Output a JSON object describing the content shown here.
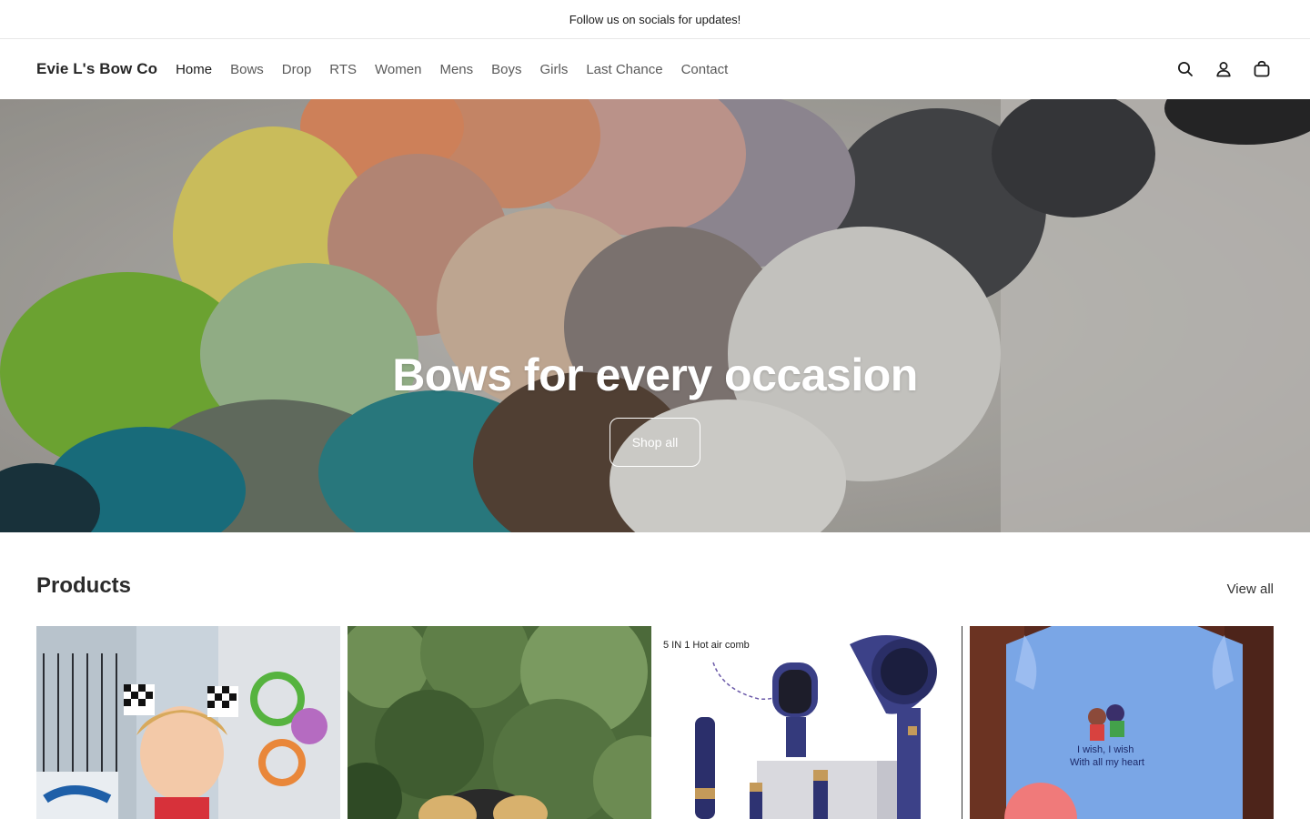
{
  "announcement": {
    "text": "Follow us on socials for updates!"
  },
  "header": {
    "logo": "Evie L's Bow Co",
    "nav": [
      "Home",
      "Bows",
      "Drop",
      "RTS",
      "Women",
      "Mens",
      "Boys",
      "Girls",
      "Last Chance",
      "Contact"
    ],
    "active_nav": "Home",
    "icons": [
      "search-icon",
      "account-icon",
      "cart-icon"
    ]
  },
  "hero": {
    "title": "Bows for every occasion",
    "button_label": "Shop all"
  },
  "products": {
    "title": "Products",
    "view_all_label": "View all",
    "cards": [
      {
        "image": "toddler-with-checkered-bows"
      },
      {
        "image": "bow-outdoors-greenery"
      },
      {
        "image": "hot-air-comb",
        "caption": "5 IN 1 Hot air comb"
      },
      {
        "image": "blue-embroidered-shirt",
        "caption_line1": "I wish, I wish",
        "caption_line2": "With all my heart"
      }
    ]
  },
  "colors": {
    "text": "#1a1a1a",
    "nav_text": "#595959",
    "border": "#e8e8e8",
    "white": "#ffffff"
  }
}
